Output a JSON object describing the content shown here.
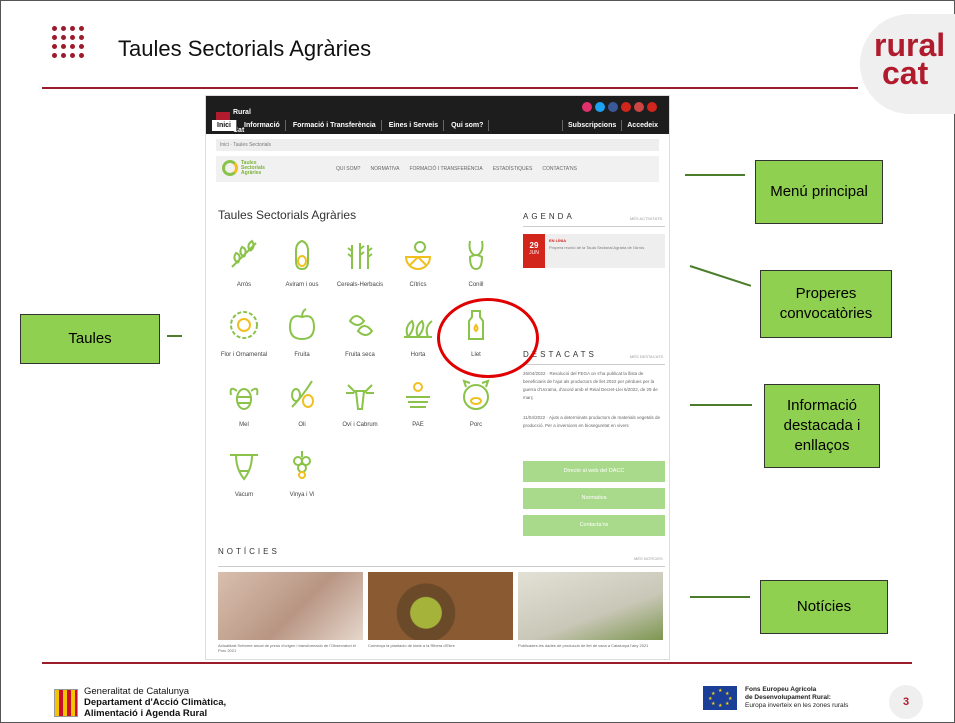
{
  "slide": {
    "title": "Taules Sectorials Agràries",
    "logo_line1": "rural",
    "logo_line2": "cat",
    "page_number": "3"
  },
  "site": {
    "brand_line1": "Rural",
    "brand_line2": "Cat",
    "nav": [
      "Inici",
      "Informació",
      "Formació i Transferència",
      "Eines i Serveis",
      "Qui som?"
    ],
    "nav_right": [
      "Subscripcions",
      "Accedeix"
    ],
    "breadcrumb": "Inici · Taules Sectorials",
    "sublogo": "Taules Sectorials Agràries",
    "submenu": [
      "QUI SOM?",
      "NORMATIVA",
      "FORMACIÓ I TRANSFERÈNCIA",
      "ESTADÍSTIQUES",
      "CONTACTA'NS"
    ],
    "content_title": "Taules Sectorials Agràries",
    "taules": [
      "Arròs",
      "Aviram i ous",
      "Cereals-Herbacis",
      "Cítrics",
      "Conill",
      "Flor i Ornamental",
      "Fruita",
      "Fruita seca",
      "Horta",
      "Llet",
      "Mel",
      "Oli",
      "Oví i Cabrum",
      "PAE",
      "Porc",
      "Vacum",
      "Vinya i Vi"
    ],
    "agenda": {
      "title": "AGENDA",
      "more": "MÉS ACTIVITATS",
      "day": "29",
      "month": "JUN",
      "tag": "EN LÍNIA",
      "text": "Propera reunió de la Taula Sectorial Agrària de l'Arròs"
    },
    "destacats": {
      "title": "DESTACATS",
      "more": "MÉS DESTACATS",
      "item1": "26/04/2022 · Resolució del FEGA on s'ha publicat la llista de beneficiaris de l'ajut als productors de llet 2022 per pèrdues per la guerra d'Ucraïna, d'acord amb el Reial Decret-Llei 6/2022, de 29 de març",
      "item2": "11/04/2022 · Ajuts a determinats productors de materials vegetals de producció. Per a inversions en bioseguretat en vivers",
      "buttons": [
        "Directe al web del DACC",
        "Normativa",
        "Contacta'ns"
      ]
    },
    "noticies": {
      "title": "NOTÍCIES",
      "more": "MÉS NOTÍCIES",
      "items": [
        "Actualitzat l'informe anual de preus d'origen i transformació de l'Observatori el Porc 2021",
        "Comença la plantació de kiwis a la Ribera d'Ebre",
        "Publicades les dades de producció de llet de vaca a Catalunya l'any 2021"
      ]
    }
  },
  "callouts": {
    "menu": "Menú principal",
    "convocatories": "Properes convocatòries",
    "taules": "Taules",
    "informacio": "Informació destacada i enllaços",
    "noticies": "Notícies"
  },
  "footer": {
    "gencat1": "Generalitat de Catalunya",
    "gencat2": "Departament d'Acció Climàtica,",
    "gencat3": "Alimentació i Agenda Rural",
    "eu1": "Fons Europeu Agrícola",
    "eu2": "de Desenvolupament Rural:",
    "eu3": "Europa inverteix en les zones rurals"
  },
  "colors": {
    "accent": "#9b1b2a",
    "callout_green": "#90d050",
    "icon_green": "#8bc34a",
    "button_green": "#a9d98b",
    "highlight_red": "#e00000"
  }
}
